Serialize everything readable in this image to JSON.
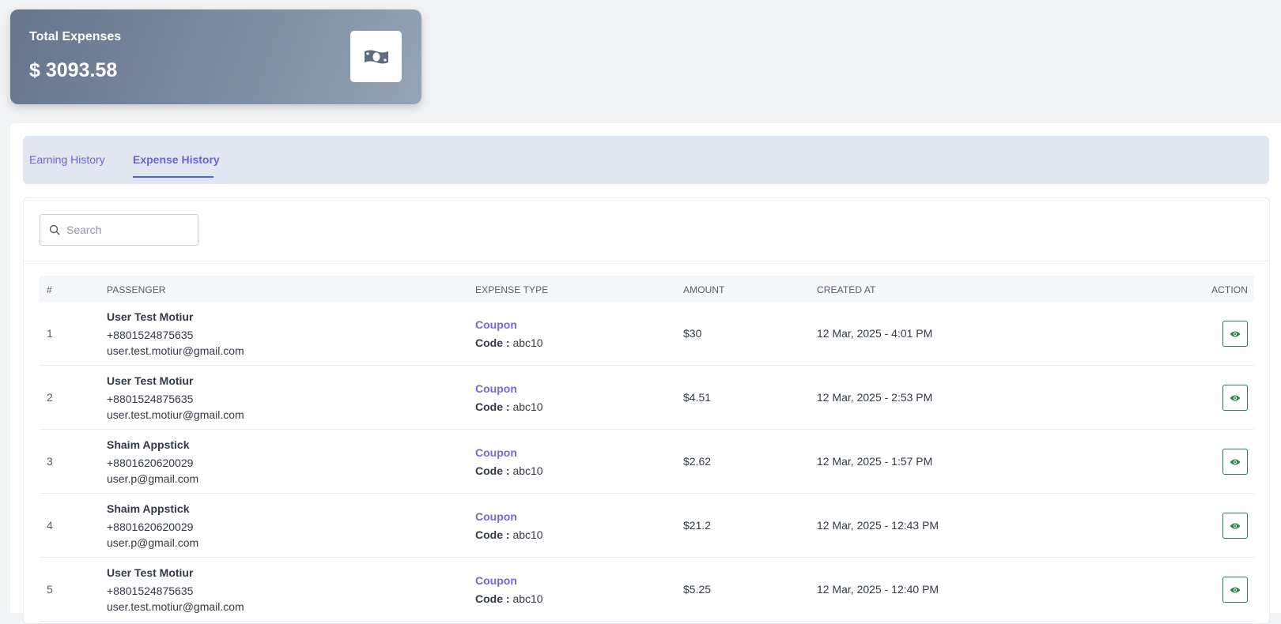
{
  "summary": {
    "title": "Total Expenses",
    "value": "$ 3093.58",
    "icon": "money-bill-icon"
  },
  "tabs": [
    {
      "label": "Earning History",
      "active": false
    },
    {
      "label": "Expense History",
      "active": true
    }
  ],
  "search": {
    "placeholder": "Search",
    "value": ""
  },
  "table": {
    "columns": [
      "#",
      "PASSENGER",
      "EXPENSE TYPE",
      "AMOUNT",
      "CREATED AT",
      "ACTION"
    ],
    "rows": [
      {
        "index": "1",
        "name": "User Test Motiur",
        "phone": "+8801524875635",
        "email": "user.test.motiur@gmail.com",
        "expense_type": "Coupon",
        "code_label": "Code :",
        "code": "abc10",
        "amount": "$30",
        "created_at": "12 Mar, 2025 - 4:01 PM"
      },
      {
        "index": "2",
        "name": "User Test Motiur",
        "phone": "+8801524875635",
        "email": "user.test.motiur@gmail.com",
        "expense_type": "Coupon",
        "code_label": "Code :",
        "code": "abc10",
        "amount": "$4.51",
        "created_at": "12 Mar, 2025 - 2:53 PM"
      },
      {
        "index": "3",
        "name": "Shaim Appstick",
        "phone": "+8801620620029",
        "email": "user.p@gmail.com",
        "expense_type": "Coupon",
        "code_label": "Code :",
        "code": "abc10",
        "amount": "$2.62",
        "created_at": "12 Mar, 2025 - 1:57 PM"
      },
      {
        "index": "4",
        "name": "Shaim Appstick",
        "phone": "+8801620620029",
        "email": "user.p@gmail.com",
        "expense_type": "Coupon",
        "code_label": "Code :",
        "code": "abc10",
        "amount": "$21.2",
        "created_at": "12 Mar, 2025 - 12:43 PM"
      },
      {
        "index": "5",
        "name": "User Test Motiur",
        "phone": "+8801524875635",
        "email": "user.test.motiur@gmail.com",
        "expense_type": "Coupon",
        "code_label": "Code :",
        "code": "abc10",
        "amount": "$5.25",
        "created_at": "12 Mar, 2025 - 12:40 PM"
      }
    ]
  },
  "colors": {
    "accent": "#6a63d8",
    "tab_underline": "#4a64db",
    "action_green": "#2e7d4a",
    "card_gradient_start": "#66758c",
    "card_gradient_end": "#97a4b7"
  }
}
